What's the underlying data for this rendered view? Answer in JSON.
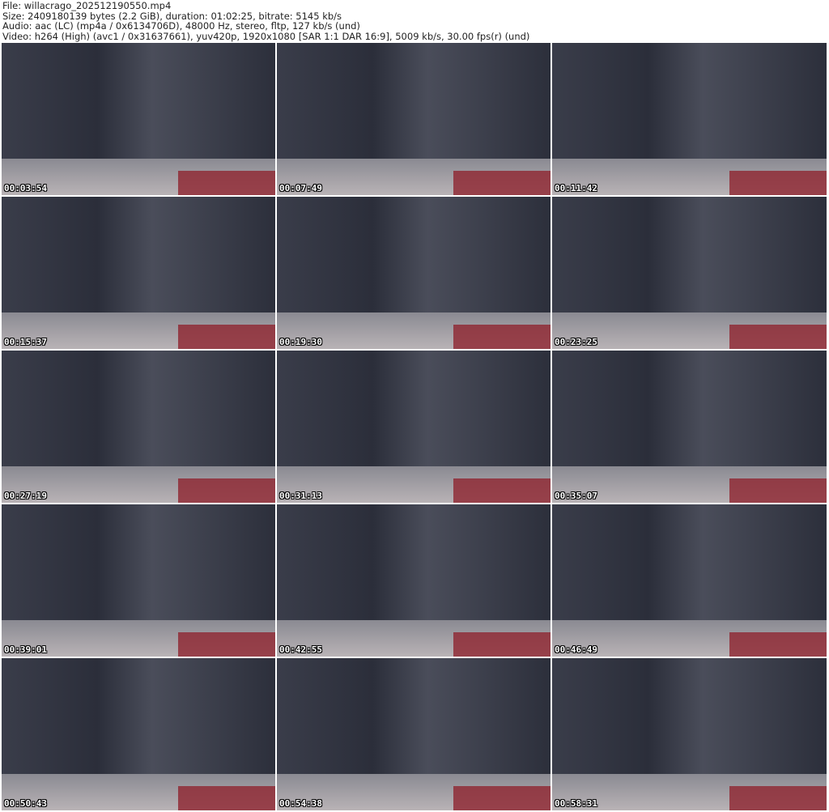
{
  "header": {
    "file": "File: willacrago_202512190550.mp4",
    "size": "Size: 2409180139 bytes (2.2 GiB), duration: 01:02:25, bitrate: 5145 kb/s",
    "audio": "Audio: aac (LC) (mp4a / 0x6134706D), 48000 Hz, stereo, fltp, 127 kb/s (und)",
    "video": "Video: h264 (High) (avc1 / 0x31637661), yuv420p, 1920x1080 [SAR 1:1 DAR 16:9], 5009 kb/s, 30.00 fps(r) (und)"
  },
  "thumbnails": [
    "00:03:54",
    "00:07:49",
    "00:11:42",
    "00:15:37",
    "00:19:30",
    "00:23:25",
    "00:27:19",
    "00:31:13",
    "00:35:07",
    "00:39:01",
    "00:42:55",
    "00:46:49",
    "00:50:43",
    "00:54:38",
    "00:58:31"
  ]
}
